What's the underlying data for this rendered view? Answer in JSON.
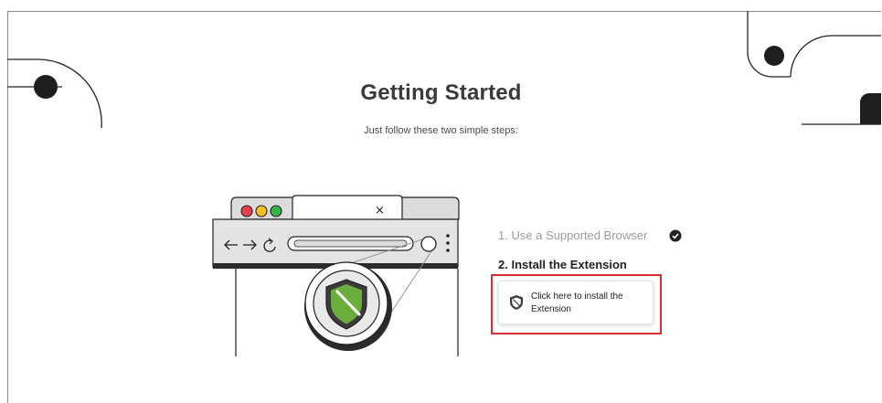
{
  "header": {
    "title": "Getting Started",
    "subtitle": "Just follow these two simple steps:"
  },
  "illustration": {
    "browser_close_glyph": "×",
    "colors": {
      "red": "#e8404a",
      "yellow": "#f5c21b",
      "green": "#37b24a",
      "shield_green": "#6cae3d"
    },
    "icons": [
      "back-arrow-icon",
      "forward-arrow-icon",
      "reload-icon",
      "kebab-menu-icon",
      "shield-icon"
    ]
  },
  "steps": {
    "step1_label": "1. Use a Supported Browser",
    "step1_done": true,
    "step2_label": "2. Install the Extension",
    "install_button_label": "Click here to install the Extension"
  },
  "colors": {
    "highlight_border": "#d9322c",
    "text_dark": "#222222",
    "text_muted": "#9a9a9a"
  }
}
